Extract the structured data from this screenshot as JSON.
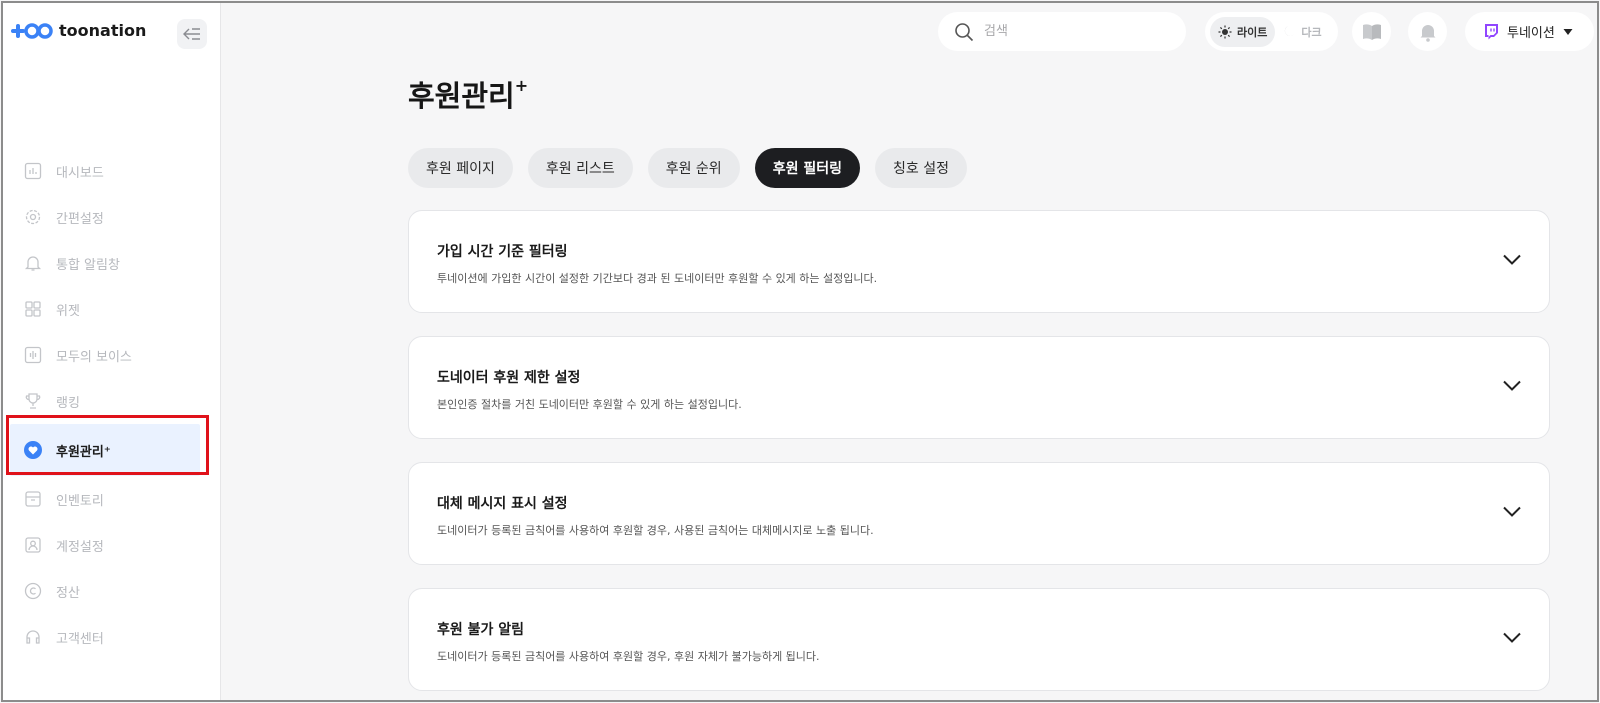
{
  "brand": {
    "name": "toonation"
  },
  "sidebar": {
    "items": [
      {
        "label": "대시보드",
        "icon": "dashboard-icon"
      },
      {
        "label": "간편설정",
        "icon": "gear-icon"
      },
      {
        "label": "통합 알림창",
        "icon": "bell-icon"
      },
      {
        "label": "위젯",
        "icon": "widget-grid-icon"
      },
      {
        "label": "모두의 보이스",
        "icon": "voice-icon"
      },
      {
        "label": "랭킹",
        "icon": "trophy-icon"
      },
      {
        "label": "후원관리⁺",
        "icon": "heart-icon",
        "active": true
      },
      {
        "label": "인벤토리",
        "icon": "inventory-icon"
      },
      {
        "label": "계정설정",
        "icon": "account-icon"
      },
      {
        "label": "정산",
        "icon": "copyright-icon"
      },
      {
        "label": "고객센터",
        "icon": "headset-icon"
      }
    ]
  },
  "topbar": {
    "search_placeholder": "검색",
    "theme": {
      "light_label": "라이트",
      "dark_label": "다크",
      "selected": "light"
    },
    "user_name": "투네이션"
  },
  "page": {
    "title": "후원관리",
    "title_sup": "+",
    "tabs": [
      {
        "label": "후원 페이지"
      },
      {
        "label": "후원 리스트"
      },
      {
        "label": "후원 순위"
      },
      {
        "label": "후원 필터링",
        "active": true
      },
      {
        "label": "칭호 설정"
      }
    ],
    "sections": [
      {
        "title": "가입 시간 기준 필터링",
        "desc": "투네이션에 가입한 시간이 설정한 기간보다 경과 된 도네이터만 후원할 수 있게 하는 설정입니다."
      },
      {
        "title": "도네이터 후원 제한 설정",
        "desc": "본인인증 절차를 거친 도네이터만 후원할 수 있게 하는 설정입니다."
      },
      {
        "title": "대체 메시지 표시 설정",
        "desc": "도네이터가 등록된 금칙어를 사용하여 후원할 경우, 사용된 금칙어는 대체메시지로 노출 됩니다."
      },
      {
        "title": "후원 불가 알림",
        "desc": "도네이터가 등록된 금칙어를 사용하여 후원할 경우, 후원 자체가 불가능하게 됩니다."
      }
    ]
  },
  "colors": {
    "accent": "#3b82f6",
    "highlight": "#e0121a",
    "active_tab": "#1d1e21",
    "twitch": "#9146ff"
  }
}
